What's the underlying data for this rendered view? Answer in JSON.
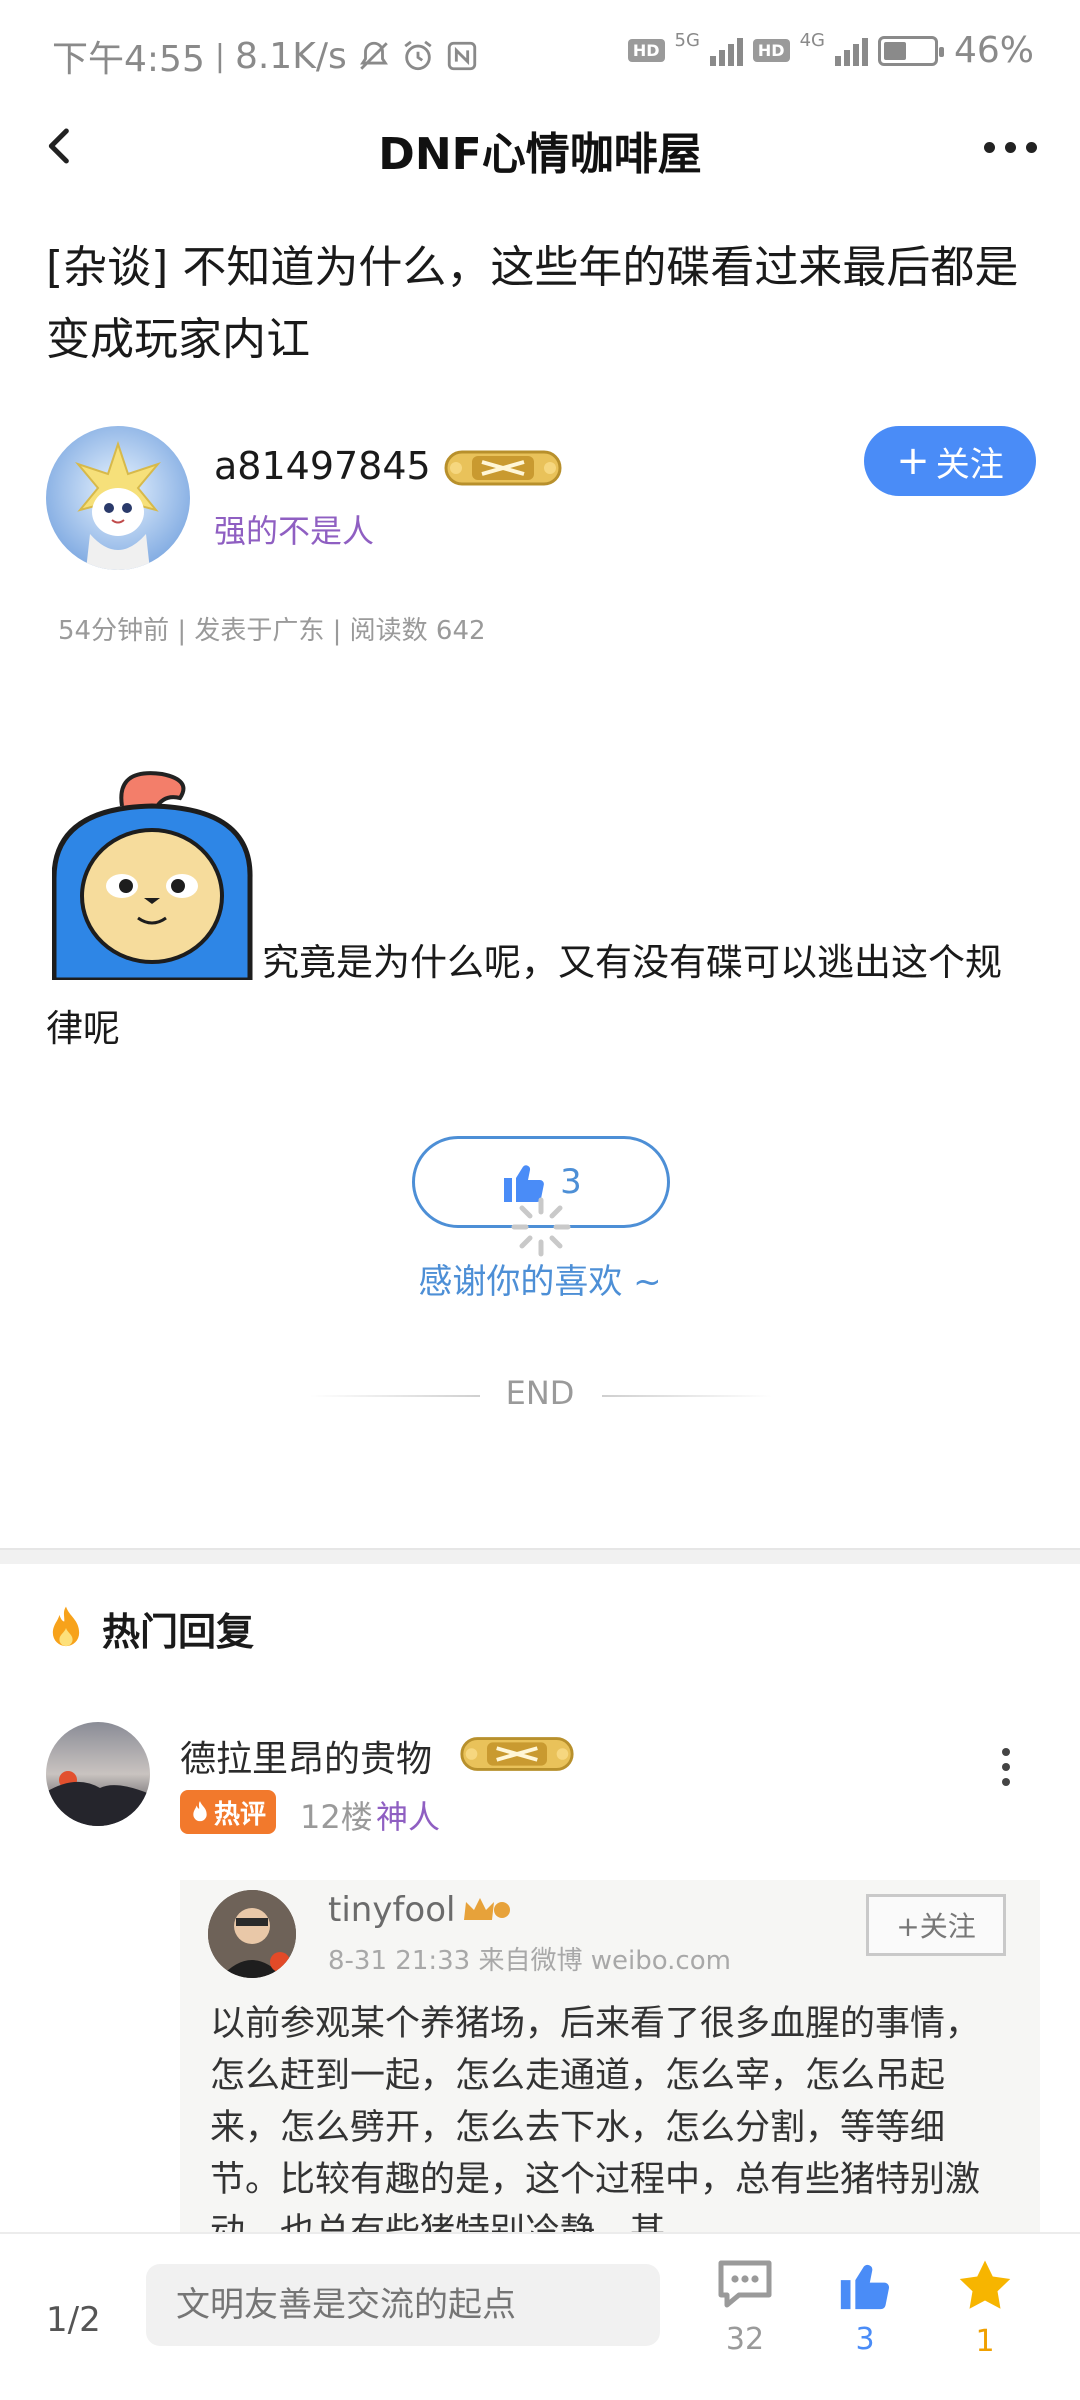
{
  "status": {
    "time": "下午4:55",
    "speed": "8.1K/s",
    "net1": "5G",
    "net2": "4G",
    "hd": "HD",
    "battery": "46%",
    "battery_level": 0.46
  },
  "nav": {
    "title": "DNF心情咖啡屋"
  },
  "post": {
    "title": "[杂谈] 不知道为什么，这些年的碟看过来最后都是变成玩家内讧",
    "author": {
      "name": "a81497845",
      "signature": "强的不是人",
      "follow_label": "关注"
    },
    "meta": "54分钟前 | 发表于广东 | 阅读数 642",
    "content": "究竟是为什么呢，又有没有碟可以逃出这个规律呢",
    "likes": "3",
    "thanks": "感谢你的喜欢 ~",
    "end": "END"
  },
  "hot": {
    "header": "热门回复",
    "reply": {
      "name": "德拉里昂的贵物",
      "tag": "热评",
      "floor": "12楼",
      "level": "神人",
      "embed": {
        "name": "tinyfool",
        "time": "8-31 21:33  来自微博 weibo.com",
        "follow": "+关注",
        "text": "以前参观某个养猪场，后来看了很多血腥的事情，怎么赶到一起，怎么走通道，怎么宰，怎么吊起来，怎么劈开，怎么去下水，怎么分割，等等细节。比较有趣的是，这个过程中，总有些猪特别激动，也总有些猪特别冷静，甚"
      }
    }
  },
  "bottom": {
    "page": "1/2",
    "input_placeholder": "文明友善是交流的起点",
    "comments": "32",
    "likes": "3",
    "stars": "1"
  },
  "colors": {
    "accent_blue": "#4a8cf7",
    "like_blue": "#4d8fd6",
    "level_purple": "#8f5fc2",
    "hot_orange": "#f2792c",
    "star_yellow": "#f7b500"
  }
}
